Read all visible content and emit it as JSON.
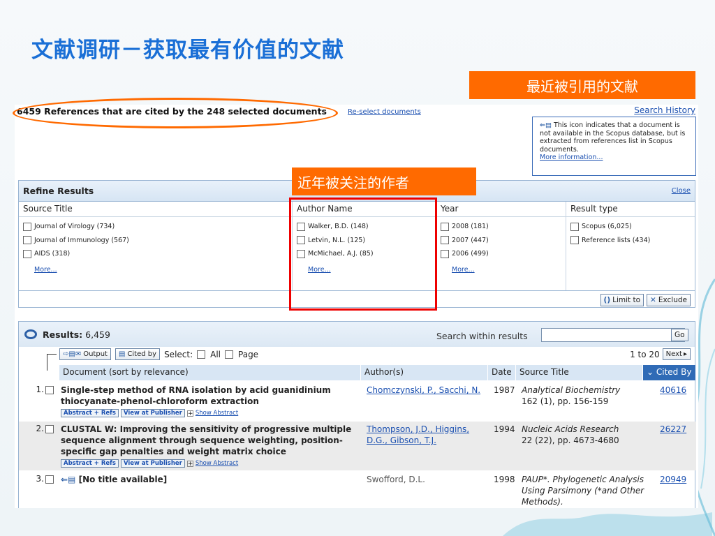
{
  "slide": {
    "title": "文献调研－获取最有价值的文献",
    "callout_recent": "最近被引用的文献",
    "callout_authors": "近年被关注的作者"
  },
  "header": {
    "references_heading": "6459 References that are cited by the 248 selected documents",
    "reselect_link": "Re-select documents",
    "search_history_link": "Search History",
    "info_text": "This icon indicates that a document is not available in the Scopus database, but is extracted from references list in Scopus documents.",
    "info_more": "More information..."
  },
  "refine": {
    "title": "Refine Results",
    "close": "Close",
    "columns": [
      {
        "header": "Source Title",
        "items": [
          "Journal of Virology (734)",
          "Journal of Immunology (567)",
          "AIDS (318)"
        ],
        "more": "More..."
      },
      {
        "header": "Author Name",
        "items": [
          "Walker, B.D. (148)",
          "Letvin, N.L. (125)",
          "McMichael, A.J. (85)"
        ],
        "more": "More..."
      },
      {
        "header": "Year",
        "items": [
          "2008 (181)",
          "2007 (447)",
          "2006 (499)"
        ],
        "more": "More..."
      },
      {
        "header": "Result type",
        "items": [
          "Scopus (6,025)",
          "Reference lists (434)"
        ],
        "more": ""
      }
    ],
    "limit_to": "Limit to",
    "exclude": "Exclude"
  },
  "results": {
    "label": "Results:",
    "count": "6,459",
    "search_within": "Search within results",
    "go": "Go",
    "output": "Output",
    "cited_by": "Cited by",
    "select_label": "Select:",
    "select_all": "All",
    "select_page": "Page",
    "pager_text": "1 to 20",
    "next": "Next",
    "columns": {
      "document": "Document (sort by relevance)",
      "authors": "Author(s)",
      "date": "Date",
      "source": "Source Title",
      "cited": "Cited By"
    },
    "abstract_refs": "Abstract + Refs",
    "view_publisher": "View at Publisher",
    "show_abstract": "Show Abstract",
    "rows": [
      {
        "num": "1.",
        "title": "Single-step method of RNA isolation by acid guanidinium thiocyanate-phenol-chloroform extraction",
        "authors": "Chomczynski, P., Sacchi, N.",
        "date": "1987",
        "source": "Analytical Biochemistry",
        "source_detail": "162 (1), pp. 156-159",
        "cited": "40616"
      },
      {
        "num": "2.",
        "title": "CLUSTAL W: Improving the sensitivity of progressive multiple sequence alignment through sequence weighting, position-specific gap penalties and weight matrix choice",
        "authors": "Thompson, J.D., Higgins, D.G., Gibson, T.J.",
        "date": "1994",
        "source": "Nucleic Acids Research",
        "source_detail": "22 (22), pp. 4673-4680",
        "cited": "26227"
      },
      {
        "num": "3.",
        "title": "[No title available]",
        "authors": "Swofford, D.L.",
        "date": "1998",
        "source": "PAUP*. Phylogenetic Analysis Using Parsimony (*and Other Methods).",
        "source_detail": "",
        "cited": "20949"
      }
    ]
  }
}
